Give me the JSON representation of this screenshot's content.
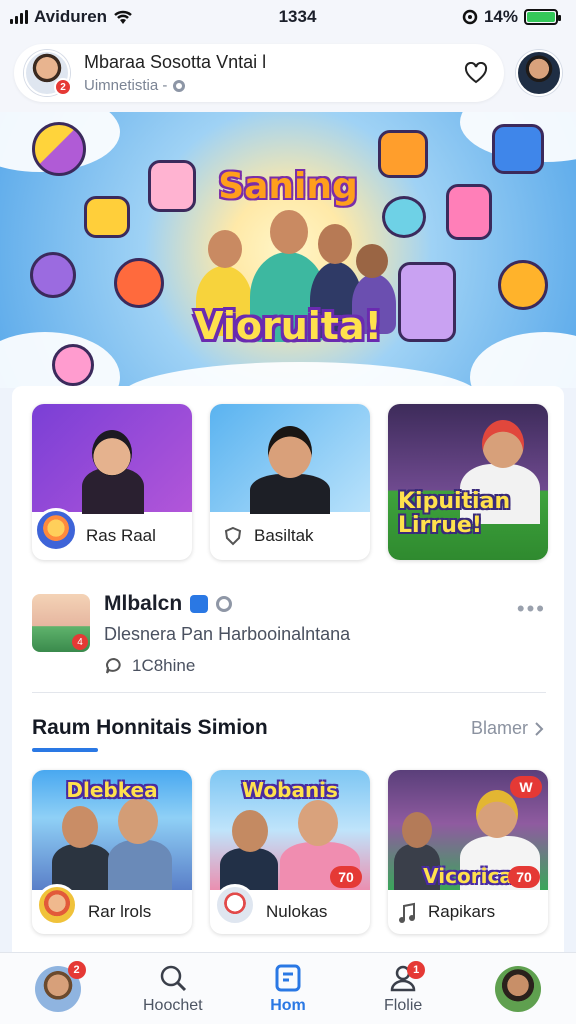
{
  "status": {
    "carrier": "Aviduren",
    "time": "1334",
    "battery": "14%"
  },
  "header": {
    "title": "Mbaraa Sosotta Vntai l",
    "subtitle": "Uimnetistia -",
    "avatar_badge": "2"
  },
  "hero": {
    "title_top": "Saning",
    "title_bottom": "Vioruita!"
  },
  "tiles": [
    {
      "label": "Ras Raal"
    },
    {
      "label": "Basiltak"
    },
    {
      "overlay": "Kipuitian Lirrue!"
    }
  ],
  "post": {
    "title": "Mlbalcn",
    "description": "Dlesnera Pan Harbooinalntana",
    "comments": "1C8hine",
    "thumb_badge": "4",
    "more": "•••"
  },
  "section": {
    "title": "Raum Honnitais Simion",
    "more": "Blamer"
  },
  "section_tiles": [
    {
      "label": "Rar lrols",
      "overlay": "Dlebkea",
      "count": ""
    },
    {
      "label": "Nulokas",
      "overlay": "Wobanis",
      "count": "70"
    },
    {
      "label": "Rapikars",
      "overlay": "Vicorica",
      "count": "70",
      "top_badge": "W"
    }
  ],
  "nav": [
    {
      "label": "",
      "badge": "2"
    },
    {
      "label": "Hoochet"
    },
    {
      "label": "Hom"
    },
    {
      "label": "Flolie",
      "badge": "1"
    },
    {
      "label": ""
    }
  ],
  "colors": {
    "accent": "#2a78e4",
    "badge": "#e53935",
    "battery": "#34c759"
  }
}
